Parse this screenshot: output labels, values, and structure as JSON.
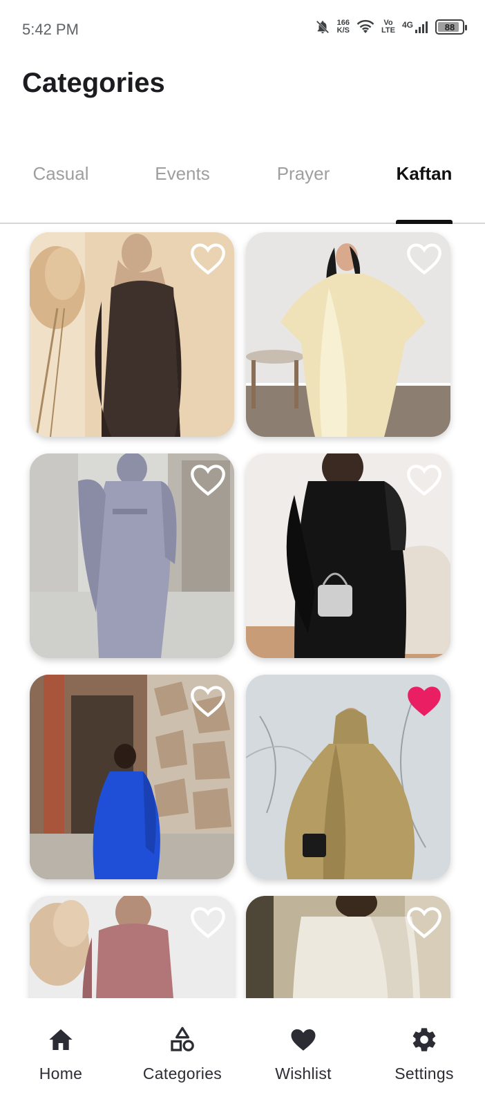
{
  "status_bar": {
    "time": "5:42 PM",
    "net_speed_value": "166",
    "net_speed_unit": "K/S",
    "volte_top": "Vo",
    "volte_bottom": "LTE",
    "network": "4G",
    "battery": "88"
  },
  "header": {
    "title": "Categories"
  },
  "tabs": [
    {
      "label": "Casual",
      "active": false
    },
    {
      "label": "Events",
      "active": false
    },
    {
      "label": "Prayer",
      "active": false
    },
    {
      "label": "Kaftan",
      "active": true
    }
  ],
  "products": [
    {
      "liked": false,
      "photo": "brown-abaya-hijab"
    },
    {
      "liked": false,
      "photo": "cream-satin-kaftan"
    },
    {
      "liked": false,
      "photo": "lilac-abaya-set"
    },
    {
      "liked": false,
      "photo": "black-feather-kaftan"
    },
    {
      "liked": false,
      "photo": "royal-blue-kaftan"
    },
    {
      "liked": true,
      "photo": "gold-pleated-abaya"
    },
    {
      "liked": false,
      "photo": "mauve-abaya-hijab"
    },
    {
      "liked": false,
      "photo": "white-lace-kaftan"
    }
  ],
  "colors": {
    "liked_heart": "#e91e63",
    "heart_outline": "#ffffff",
    "active_tab": "#111111",
    "inactive_tab": "#9e9e9e"
  },
  "bottom_nav": [
    {
      "label": "Home",
      "icon": "home-icon"
    },
    {
      "label": "Categories",
      "icon": "categories-icon"
    },
    {
      "label": "Wishlist",
      "icon": "heart-icon"
    },
    {
      "label": "Settings",
      "icon": "gear-icon"
    }
  ]
}
